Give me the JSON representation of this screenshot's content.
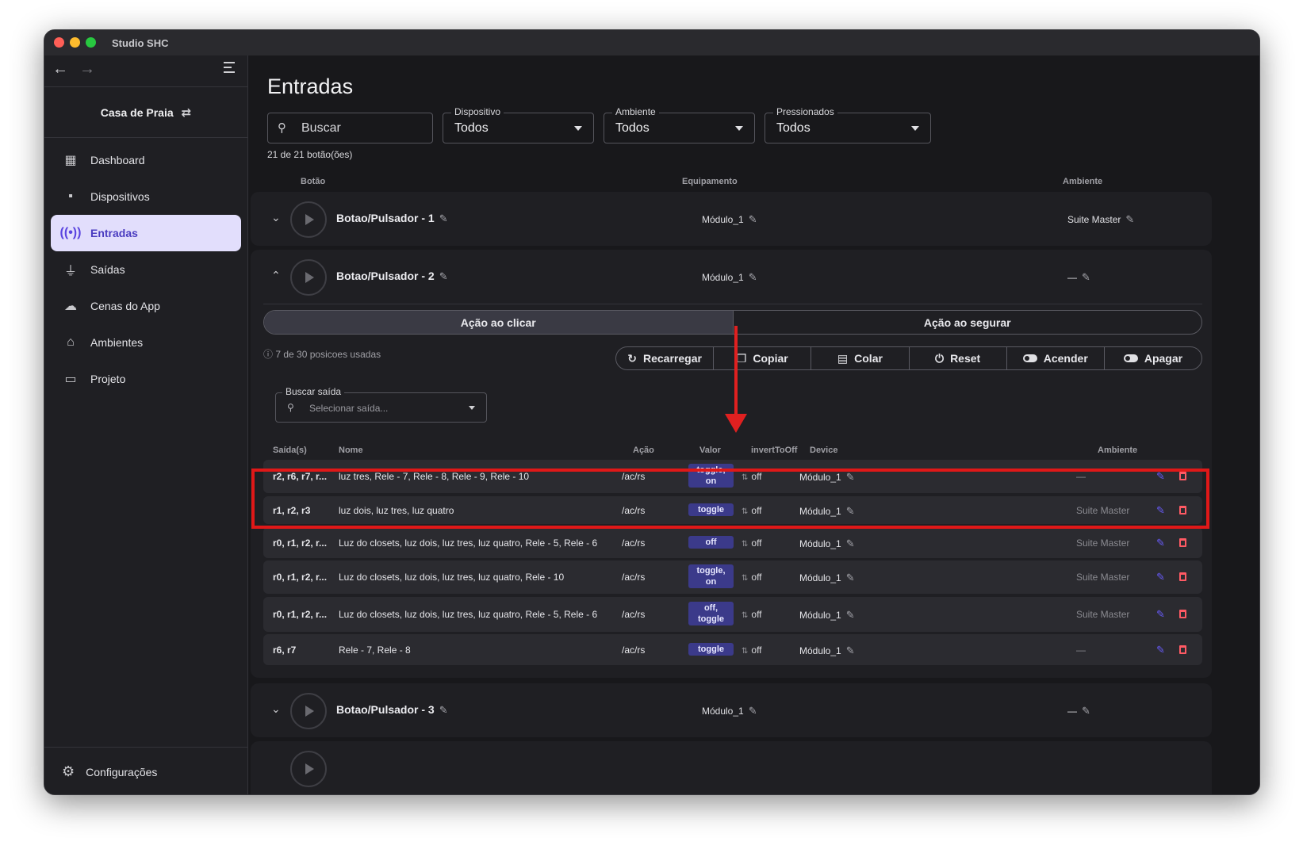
{
  "window": {
    "title": "Studio SHC"
  },
  "sidebar": {
    "project": "Casa de Praia",
    "items": [
      {
        "label": "Dashboard",
        "icon": "dashboard-icon"
      },
      {
        "label": "Dispositivos",
        "icon": "devices-icon"
      },
      {
        "label": "Entradas",
        "icon": "inputs-icon",
        "active": true
      },
      {
        "label": "Saídas",
        "icon": "plug-icon"
      },
      {
        "label": "Cenas do App",
        "icon": "cloud-icon"
      },
      {
        "label": "Ambientes",
        "icon": "door-icon"
      },
      {
        "label": "Projeto",
        "icon": "folder-icon"
      }
    ],
    "settings": "Configurações"
  },
  "page": {
    "title": "Entradas",
    "filters": {
      "search_placeholder": "Buscar",
      "device_label": "Dispositivo",
      "device_value": "Todos",
      "environment_label": "Ambiente",
      "environment_value": "Todos",
      "pressed_label": "Pressionados",
      "pressed_value": "Todos"
    },
    "count": "21 de 21 botão(ões)",
    "headers": {
      "button": "Botão",
      "equipment": "Equipamento",
      "environment": "Ambiente"
    }
  },
  "buttons": [
    {
      "name": "Botao/Pulsador - 1",
      "equipment": "Módulo_1",
      "environment": "Suite Master",
      "chevron": "⌄"
    },
    {
      "name": "Botao/Pulsador - 2",
      "equipment": "Módulo_1",
      "environment": "—",
      "chevron": "⌃"
    },
    {
      "name": "Botao/Pulsador - 3",
      "equipment": "Módulo_1",
      "environment": "—",
      "chevron": "⌄"
    }
  ],
  "expanded": {
    "tabs": {
      "click": "Ação ao clicar",
      "hold": "Ação ao segurar"
    },
    "used_positions": "7 de 30 posicoes usadas",
    "actions": [
      "Recarregar",
      "Copiar",
      "Colar",
      "Reset",
      "Acender",
      "Apagar"
    ],
    "output_search": {
      "label": "Buscar saída",
      "placeholder": "Selecionar saída..."
    },
    "output_headers": {
      "outputs": "Saída(s)",
      "name": "Nome",
      "action": "Ação",
      "value": "Valor",
      "invert": "invertToOff",
      "device": "Device",
      "environment": "Ambiente"
    },
    "outputs": [
      {
        "outputs": "r2, r6, r7, r...",
        "name": "luz tres, Rele - 7, Rele - 8, Rele - 9, Rele - 10",
        "action": "/ac/rs",
        "value_l1": "toggle,",
        "value_l2": "on",
        "invert": "off",
        "device": "Módulo_1",
        "environment": "—"
      },
      {
        "outputs": "r1, r2, r3",
        "name": "luz dois, luz tres, luz quatro",
        "action": "/ac/rs",
        "value_l1": "toggle",
        "value_l2": "",
        "invert": "off",
        "device": "Módulo_1",
        "environment": "Suite Master"
      },
      {
        "outputs": "r0, r1, r2, r...",
        "name": "Luz do closets, luz dois, luz tres, luz quatro, Rele - 5, Rele - 6",
        "action": "/ac/rs",
        "value_l1": "off",
        "value_l2": "",
        "invert": "off",
        "device": "Módulo_1",
        "environment": "Suite Master"
      },
      {
        "outputs": "r0, r1, r2, r...",
        "name": "Luz do closets, luz dois, luz tres, luz quatro, Rele - 10",
        "action": "/ac/rs",
        "value_l1": "toggle,",
        "value_l2": "on",
        "invert": "off",
        "device": "Módulo_1",
        "environment": "Suite Master"
      },
      {
        "outputs": "r0, r1, r2, r...",
        "name": "Luz do closets, luz dois, luz tres, luz quatro, Rele - 5, Rele - 6",
        "action": "/ac/rs",
        "value_l1": "off,",
        "value_l2": "toggle",
        "invert": "off",
        "device": "Módulo_1",
        "environment": "Suite Master"
      },
      {
        "outputs": "r6, r7",
        "name": "Rele - 7, Rele - 8",
        "action": "/ac/rs",
        "value_l1": "toggle",
        "value_l2": "",
        "invert": "off",
        "device": "Módulo_1",
        "environment": "—"
      }
    ]
  },
  "colors": {
    "accent": "#5a44e0",
    "highlight": "#e01818",
    "delete": "#ff5a64",
    "value_badge": "#3b3a8a"
  }
}
